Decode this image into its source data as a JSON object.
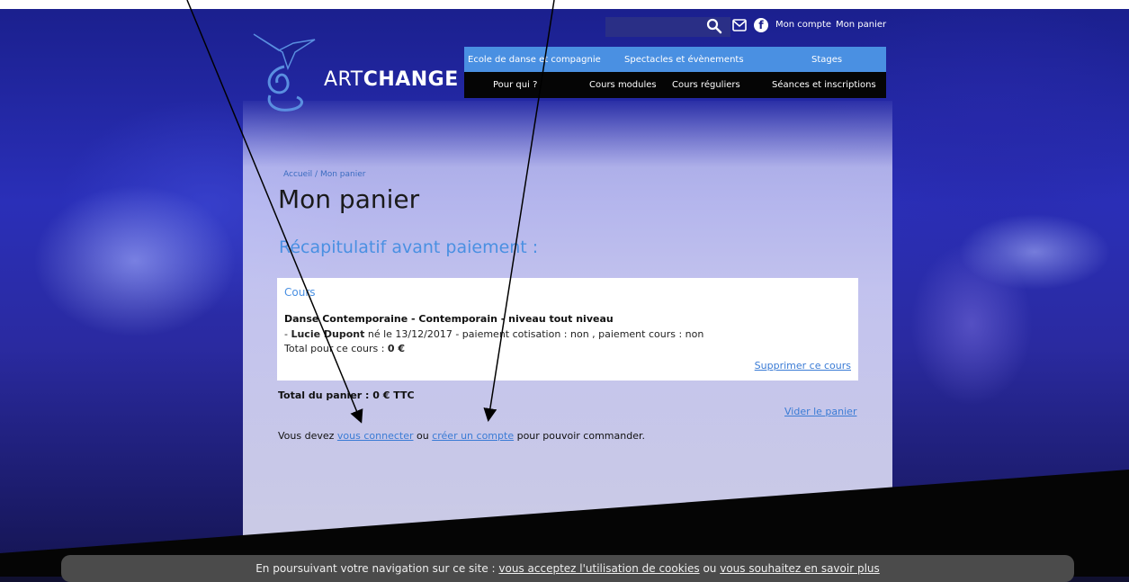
{
  "header": {
    "brand_prefix": "ART",
    "brand_strong": "CHANGE",
    "search_placeholder": "",
    "account_link": "Mon compte",
    "cart_link": "Mon panier",
    "facebook_glyph": "f"
  },
  "nav": {
    "primary": [
      "Ecole de danse et compagnie",
      "Spectacles et évènements",
      "Stages"
    ],
    "secondary": [
      "Pour qui ?",
      "Cours modules",
      "Cours réguliers",
      "Séances et inscriptions"
    ]
  },
  "breadcrumb": {
    "home": "Accueil",
    "separator": "/",
    "current": "Mon panier"
  },
  "page_title": "Mon panier",
  "recap_title": "Récapitulatif avant paiement :",
  "cart": {
    "section_label": "Cours",
    "course_name": "Danse Contemporaine - Contemporain - niveau tout niveau",
    "student_prefix": "- ",
    "student_name": "Lucie Dupont",
    "student_details": " né le 13/12/2017 - paiement cotisation : non , paiement cours : non",
    "course_total_label": "Total pour ce cours : ",
    "course_total_value": "0 €",
    "remove_label": "Supprimer ce cours",
    "cart_total": "Total du panier : 0 € TTC",
    "empty_label": "Vider le panier"
  },
  "login_message": {
    "prefix": "Vous devez ",
    "login_link": "vous connecter",
    "middle": " ou ",
    "create_link": "créer un compte",
    "suffix": " pour pouvoir commander."
  },
  "cookie_bar": {
    "prefix": "En poursuivant votre navigation sur ce site : ",
    "accept_link": "vous acceptez l'utilisation de cookies",
    "middle": " ou ",
    "more_link": "vous souhaitez en savoir plus"
  },
  "colors": {
    "accent": "#4a90e2",
    "link": "#3a7bd5",
    "nav_dark": "#050505",
    "cookie_bg": "#4b4b4b"
  }
}
